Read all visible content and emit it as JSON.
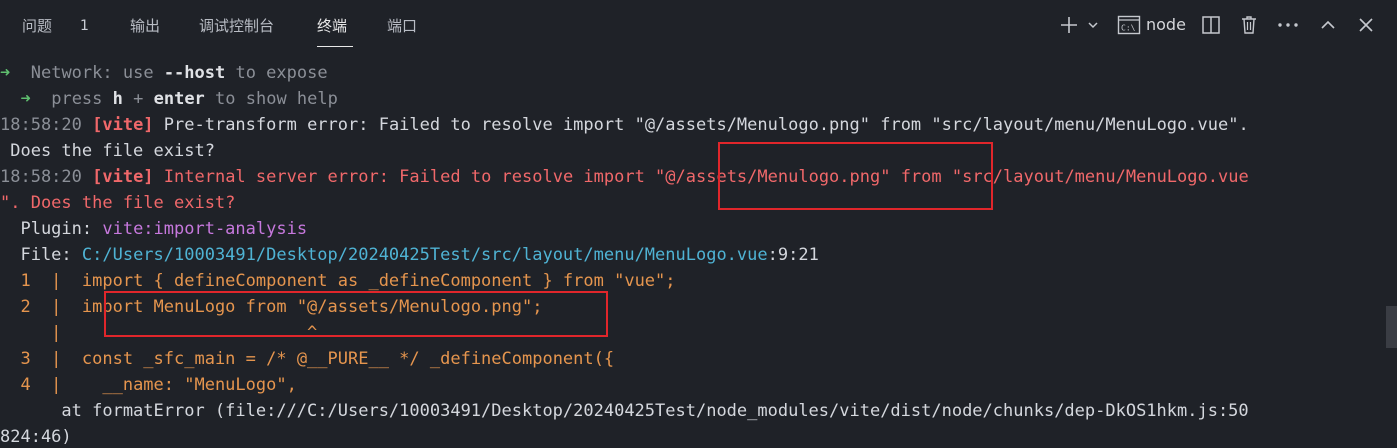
{
  "tabs": [
    {
      "label": "问题"
    },
    {
      "label": "输出"
    },
    {
      "label": "调试控制台"
    },
    {
      "label": "终端"
    },
    {
      "label": "端口"
    }
  ],
  "problems_count": "1",
  "active_tab": "终端",
  "toolbar": {
    "terminal_name": "node",
    "icons": [
      "plus-icon",
      "chevron-down-icon",
      "terminal-icon",
      "split-icon",
      "trash-icon",
      "more-icon",
      "chevron-up-icon",
      "close-icon"
    ]
  },
  "terminal": {
    "line1": {
      "arrow": "➜",
      "label": "Network",
      "mid": ": use ",
      "flag": "--host",
      "rest": " to expose"
    },
    "line2": {
      "arrow": "➜",
      "pre": "press ",
      "key1": "h",
      "plus": " + ",
      "key2": "enter",
      "rest": " to show help"
    },
    "line3": {
      "time": "18:58:20 ",
      "tag": "[vite]",
      "msg": " Pre-transform error: Failed to resolve import \"@/assets/Menulogo.png\" from \"src/layout/menu/MenuLogo.vue\"."
    },
    "line4": {
      "msg": " Does the file exist?"
    },
    "line5": {
      "time": "18:58:20 ",
      "tag": "[vite]",
      "msg": " Internal server error: Failed to resolve import \"@/assets/Menulogo.png\" from \"src/layout/menu/MenuLogo.vue"
    },
    "line6": {
      "msg": "\". Does the file exist?"
    },
    "line7": {
      "label": "  Plugin: ",
      "value": "vite:import-analysis"
    },
    "line8": {
      "label": "  File: ",
      "path": "C:/Users/10003491/Desktop/20240425Test/src/layout/menu/MenuLogo.vue",
      "pos": ":9:21"
    },
    "line9": {
      "num": "  1  |  ",
      "code": "import { defineComponent as _defineComponent } from \"vue\";"
    },
    "line10": {
      "num": "  2  |  ",
      "code": "import MenuLogo from \"@/assets/Menulogo.png\";"
    },
    "line11": {
      "num": "     |  ",
      "code": "                      ^"
    },
    "line12": {
      "num": "  3  |  ",
      "code": "const _sfc_main = /* @__PURE__ */ _defineComponent({"
    },
    "line13": {
      "num": "  4  |  ",
      "code": "  __name: \"MenuLogo\","
    },
    "line14": {
      "msg": "      at formatError (file:///C:/Users/10003491/Desktop/20240425Test/node_modules/vite/dist/node/chunks/dep-DkOS1hkm.js:50"
    },
    "line15": {
      "msg": "824:46)"
    }
  },
  "colors": {
    "background": "#1f2228",
    "error_red": "#f0686a",
    "highlight_box": "#e0262b",
    "path_cyan": "#4fb3d4",
    "code_orange": "#e5954e",
    "plugin_purple": "#c678dd",
    "arrow_green": "#5fbf6f"
  }
}
